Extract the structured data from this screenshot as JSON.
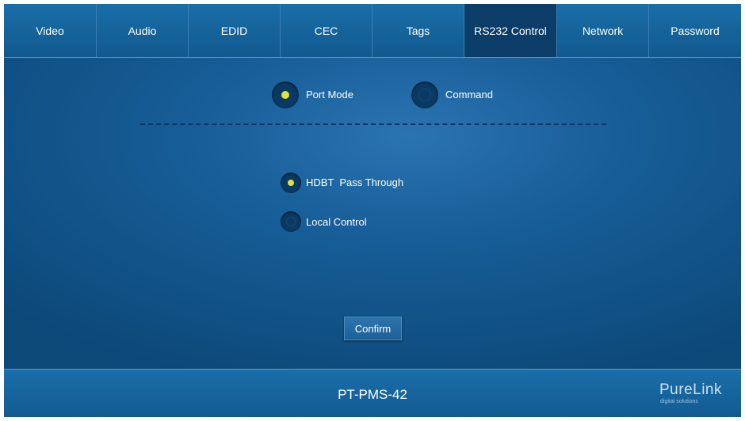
{
  "tabs": [
    {
      "label": "Video",
      "active": false
    },
    {
      "label": "Audio",
      "active": false
    },
    {
      "label": "EDID",
      "active": false
    },
    {
      "label": "CEC",
      "active": false
    },
    {
      "label": "Tags",
      "active": false
    },
    {
      "label": "RS232 Control",
      "active": true
    },
    {
      "label": "Network",
      "active": false
    },
    {
      "label": "Password",
      "active": false
    }
  ],
  "mode": {
    "options": [
      {
        "label": "Port Mode",
        "selected": true
      },
      {
        "label": "Command",
        "selected": false
      }
    ]
  },
  "port": {
    "options": [
      {
        "label": "HDBT  Pass Through",
        "selected": true
      },
      {
        "label": "Local Control",
        "selected": false
      }
    ]
  },
  "confirm_label": "Confirm",
  "footer": {
    "model": "PT-PMS-42",
    "logo_text": "PureLink",
    "logo_subtext": "digital solutions"
  },
  "colors": {
    "accent_dot": "#dfe33a",
    "active_tab": "#0b3d68",
    "background": "#0e4f84"
  }
}
